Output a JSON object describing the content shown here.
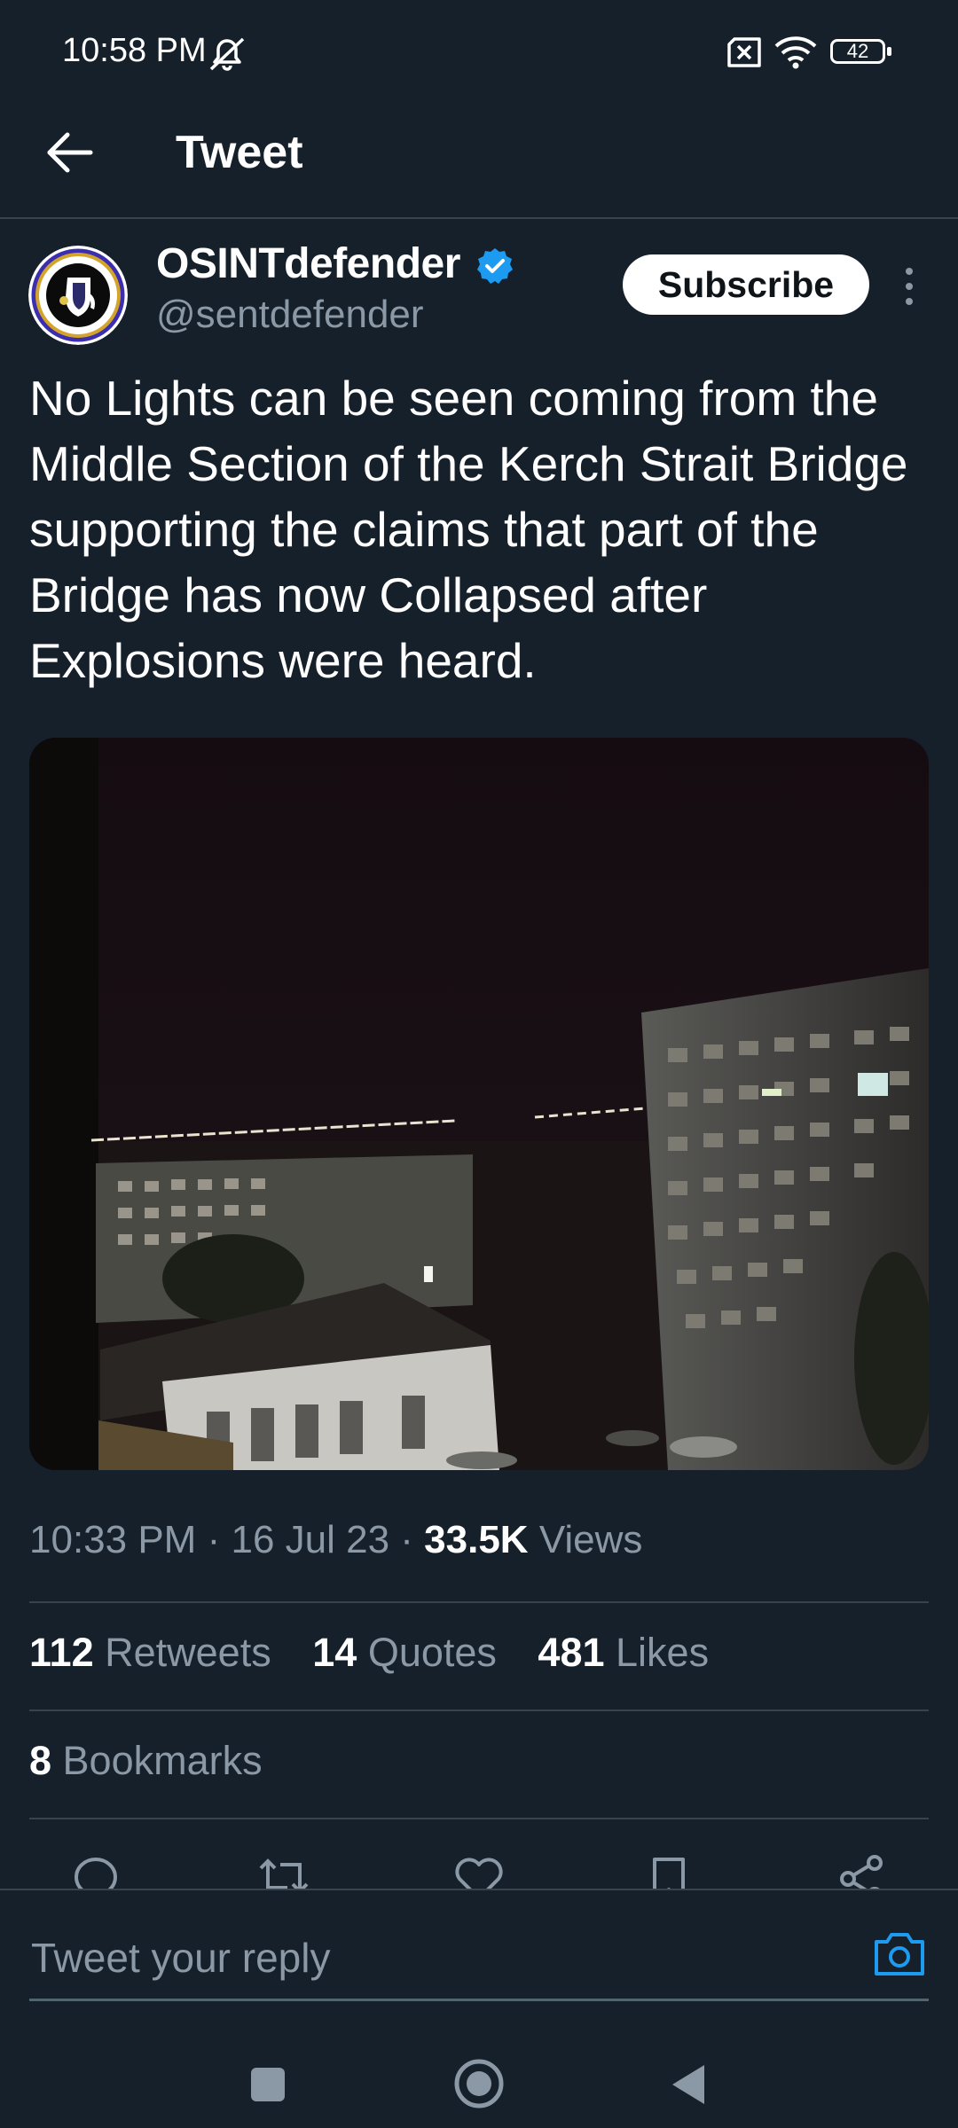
{
  "status_bar": {
    "time": "10:58 PM",
    "icons": [
      "mute-icon",
      "no-sim-icon",
      "wifi-icon",
      "battery-icon"
    ],
    "battery_level": "42"
  },
  "header": {
    "title": "Tweet",
    "back_icon": "arrow-left-icon"
  },
  "tweet": {
    "author": {
      "name": "OSINTdefender",
      "handle": "@sentdefender",
      "verified": true
    },
    "subscribe_label": "Subscribe",
    "text": "No Lights can be seen coming from the Middle Section of the Kerch Strait Bridge supporting the claims that part of the Bridge has now Collapsed after Explosions were heard.",
    "time": "10:33 PM",
    "date": "16 Jul 23",
    "separator": "·",
    "views_count": "33.5K",
    "views_label": "Views",
    "stats": {
      "retweets_count": "112",
      "retweets_label": "Retweets",
      "quotes_count": "14",
      "quotes_label": "Quotes",
      "likes_count": "481",
      "likes_label": "Likes",
      "bookmarks_count": "8",
      "bookmarks_label": "Bookmarks"
    }
  },
  "actions": [
    "reply-icon",
    "retweet-icon",
    "like-icon",
    "bookmark-icon",
    "share-icon"
  ],
  "reply_bar": {
    "placeholder": "Tweet your reply",
    "camera_icon": "camera-icon"
  },
  "colors": {
    "background": "#15202b",
    "divider": "#38444d",
    "secondary_text": "#8b98a5",
    "accent": "#1d9bf0"
  }
}
